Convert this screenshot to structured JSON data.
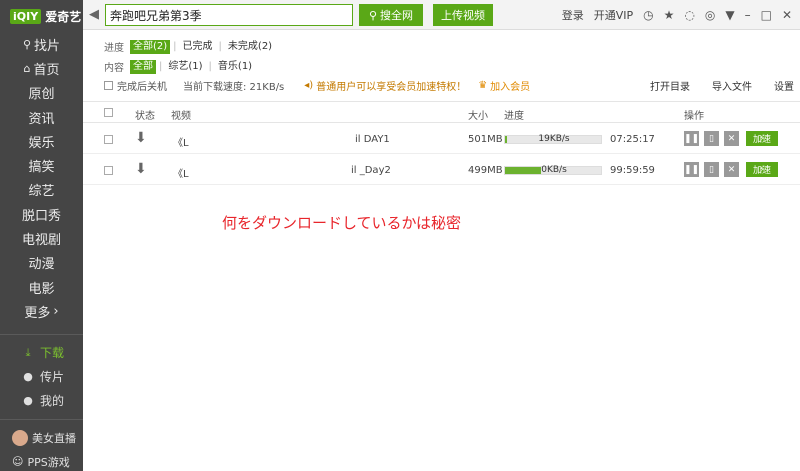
{
  "logo": {
    "box": "iQIY",
    "text": "爱奇艺"
  },
  "sidebar": {
    "items": [
      {
        "icon": "search-icon",
        "glyph": "⚲",
        "label": "找片"
      },
      {
        "icon": "home-icon",
        "glyph": "⌂",
        "label": "首页"
      },
      {
        "label": "原创"
      },
      {
        "label": "资讯"
      },
      {
        "label": "娱乐"
      },
      {
        "label": "搞笑"
      },
      {
        "label": "综艺"
      },
      {
        "label": "脱口秀"
      },
      {
        "label": "电视剧"
      },
      {
        "label": "动漫"
      },
      {
        "label": "电影"
      },
      {
        "label": "更多",
        "suffix": "›"
      }
    ],
    "sub": [
      {
        "icon": "download-icon",
        "glyph": "⤓",
        "label": "下载",
        "active": true
      },
      {
        "icon": "upload-icon",
        "glyph": "●",
        "label": "传片"
      },
      {
        "icon": "user-icon",
        "glyph": "●",
        "label": "我的"
      }
    ],
    "bottom": [
      {
        "icon": "avatar",
        "label": "美女直播"
      },
      {
        "icon": "pps-icon",
        "glyph": "☺",
        "label": "PPS游戏"
      }
    ]
  },
  "topbar": {
    "search_value": "奔跑吧兄弟第3季",
    "search_label": "搜全网",
    "upload_label": "上传视频",
    "login": "登录",
    "vip": "开通VIP"
  },
  "filters": {
    "progress_label": "进度",
    "progress": [
      "全部(2)",
      "已完成",
      "未完成(2)"
    ],
    "content_label": "内容",
    "content": [
      "全部",
      "综艺(1)",
      "音乐(1)"
    ]
  },
  "options": {
    "shutdown": "完成后关机",
    "speed": "当前下载速度: 21KB/s",
    "promo": "普通用户可以享受会员加速特权！",
    "join": "加入会员",
    "open_dir": "打开目录",
    "import": "导入文件",
    "settings": "设置"
  },
  "table": {
    "headers": {
      "status": "状态",
      "video": "视频",
      "size": "大小",
      "progress": "进度",
      "action": "操作"
    },
    "rows": [
      {
        "prefix": "《L",
        "suffix": "il DAY1",
        "size": "501MB",
        "speed": "19KB/s",
        "fill": 0.02,
        "time": "07:25:17",
        "accel": "加速"
      },
      {
        "prefix": "《L",
        "suffix": "il _Day2",
        "size": "499MB",
        "speed": "0KB/s",
        "fill": 0.38,
        "time": "99:59:59",
        "accel": "加速"
      }
    ]
  },
  "annotation": "何をダウンロードしているかは秘密"
}
